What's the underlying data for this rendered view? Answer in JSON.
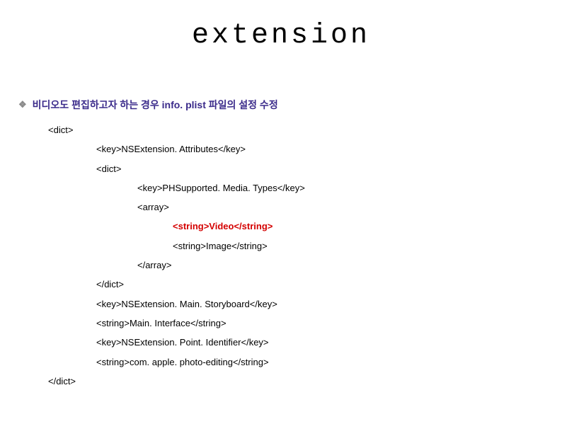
{
  "title": "extension",
  "bullet": "비디오도 편집하고자 하는 경우 info. plist 파일의 설정 수정",
  "code": {
    "l1": "<dict>",
    "l2": "<key>NSExtension. Attributes</key>",
    "l3": "<dict>",
    "l4": "<key>PHSupported. Media. Types</key>",
    "l5": "<array>",
    "l6": "<string>Video</string>",
    "l7": "<string>Image</string>",
    "l8": "</array>",
    "l9": "</dict>",
    "l10": "<key>NSExtension. Main. Storyboard</key>",
    "l11": "<string>Main. Interface</string>",
    "l12": "<key>NSExtension. Point. Identifier</key>",
    "l13": "<string>com. apple. photo-editing</string>",
    "l14": "</dict>"
  }
}
